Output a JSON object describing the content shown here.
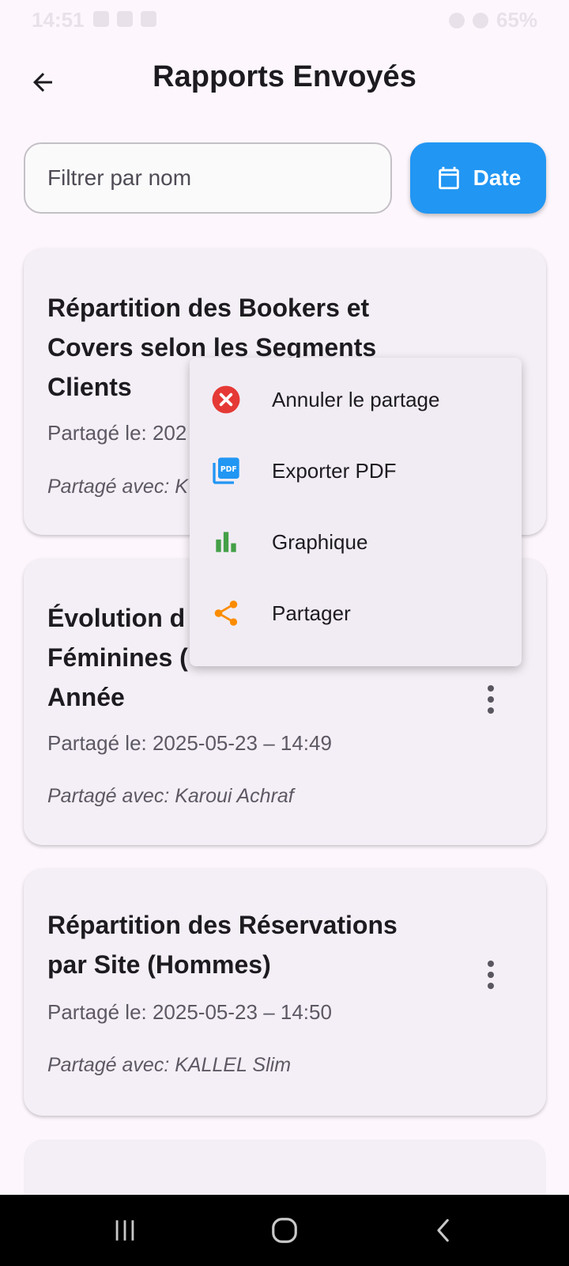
{
  "status_bar": {
    "time": "14:51",
    "battery": "65%"
  },
  "header": {
    "title": "Rapports Envoyés"
  },
  "filter": {
    "placeholder": "Filtrer par nom",
    "value": ""
  },
  "date_button": {
    "label": "Date"
  },
  "reports": [
    {
      "title_lines": [
        "Répartition des Bookers et",
        "Covers selon les Segments",
        "Clients"
      ],
      "date_prefix": "Partagé le: 202",
      "with_prefix": "Partagé avec: K"
    },
    {
      "title_lines": [
        "Évolution d",
        "Féminines (",
        "Année"
      ],
      "date": "Partagé le: 2025-05-23 – 14:49",
      "with": "Partagé avec: Karoui Achraf"
    },
    {
      "title_lines": [
        "Répartition des Réservations",
        "par Site (Hommes)"
      ],
      "date": "Partagé le: 2025-05-23 – 14:50",
      "with": "Partagé avec: KALLEL Slim"
    }
  ],
  "context_menu": {
    "items": [
      {
        "label": "Annuler le partage",
        "icon": "cancel-icon"
      },
      {
        "label": "Exporter PDF",
        "icon": "pdf-icon"
      },
      {
        "label": "Graphique",
        "icon": "bar-chart-icon"
      },
      {
        "label": "Partager",
        "icon": "share-icon"
      }
    ]
  },
  "colors": {
    "accent": "#2196f3",
    "cancel": "#e53935",
    "pdf": "#2196f3",
    "chart": "#43a047",
    "share": "#fb8c00"
  }
}
